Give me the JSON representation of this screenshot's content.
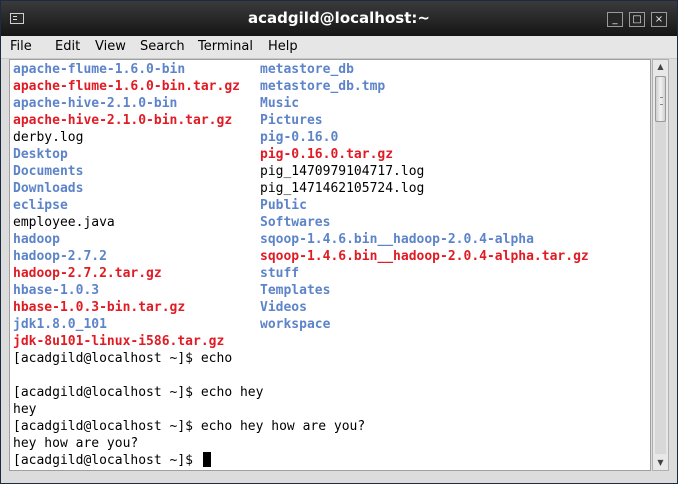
{
  "window": {
    "title": "acadgild@localhost:~",
    "minimize_label": "_",
    "maximize_label": "□",
    "close_label": "×"
  },
  "menubar": {
    "items": [
      "File",
      "Edit",
      "View",
      "Search",
      "Terminal",
      "Help"
    ]
  },
  "listing": {
    "col1": [
      {
        "name": "apache-flume-1.6.0-bin",
        "kind": "dir"
      },
      {
        "name": "apache-flume-1.6.0-bin.tar.gz",
        "kind": "archive"
      },
      {
        "name": "apache-hive-2.1.0-bin",
        "kind": "dir"
      },
      {
        "name": "apache-hive-2.1.0-bin.tar.gz",
        "kind": "archive"
      },
      {
        "name": "derby.log",
        "kind": "file"
      },
      {
        "name": "Desktop",
        "kind": "dir"
      },
      {
        "name": "Documents",
        "kind": "dir"
      },
      {
        "name": "Downloads",
        "kind": "dir"
      },
      {
        "name": "eclipse",
        "kind": "dir"
      },
      {
        "name": "employee.java",
        "kind": "file"
      },
      {
        "name": "hadoop",
        "kind": "dir"
      },
      {
        "name": "hadoop-2.7.2",
        "kind": "dir"
      },
      {
        "name": "hadoop-2.7.2.tar.gz",
        "kind": "archive"
      },
      {
        "name": "hbase-1.0.3",
        "kind": "dir"
      },
      {
        "name": "hbase-1.0.3-bin.tar.gz",
        "kind": "archive"
      },
      {
        "name": "jdk1.8.0_101",
        "kind": "dir"
      },
      {
        "name": "jdk-8u101-linux-i586.tar.gz",
        "kind": "archive"
      }
    ],
    "col2": [
      {
        "name": "metastore_db",
        "kind": "dir"
      },
      {
        "name": "metastore_db.tmp",
        "kind": "dir"
      },
      {
        "name": "Music",
        "kind": "dir"
      },
      {
        "name": "Pictures",
        "kind": "dir"
      },
      {
        "name": "pig-0.16.0",
        "kind": "dir"
      },
      {
        "name": "pig-0.16.0.tar.gz",
        "kind": "archive"
      },
      {
        "name": "pig_1470979104717.log",
        "kind": "file"
      },
      {
        "name": "pig_1471462105724.log",
        "kind": "file"
      },
      {
        "name": "Public",
        "kind": "dir"
      },
      {
        "name": "Softwares",
        "kind": "dir"
      },
      {
        "name": "sqoop-1.4.6.bin__hadoop-2.0.4-alpha",
        "kind": "dir"
      },
      {
        "name": "sqoop-1.4.6.bin__hadoop-2.0.4-alpha.tar.gz",
        "kind": "archive"
      },
      {
        "name": "stuff",
        "kind": "dir"
      },
      {
        "name": "Templates",
        "kind": "dir"
      },
      {
        "name": "Videos",
        "kind": "dir"
      },
      {
        "name": "workspace",
        "kind": "dir"
      }
    ]
  },
  "session": [
    "[acadgild@localhost ~]$ echo",
    "",
    "[acadgild@localhost ~]$ echo hey",
    "hey",
    "[acadgild@localhost ~]$ echo hey how are you?",
    "hey how are you?",
    "[acadgild@localhost ~]$ "
  ],
  "colors": {
    "directory": "#5d84c9",
    "archive": "#e01b24",
    "file": "#000000"
  },
  "icons": {
    "title": "terminal-icon",
    "scroll_up": "arrow-up-icon",
    "scroll_down": "arrow-down-icon"
  }
}
